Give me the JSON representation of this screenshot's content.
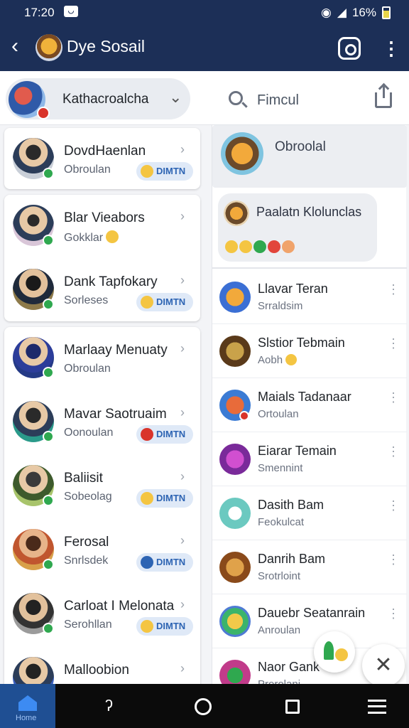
{
  "status": {
    "time": "17:20",
    "battery": "16%"
  },
  "header": {
    "title": "Dye Sosail"
  },
  "filter": {
    "selected": "Kathacroalcha",
    "search_placeholder": "Fimcul"
  },
  "left_contacts": [
    {
      "name": "DovdHaenlan",
      "sub": "Obroulan",
      "tag": "DIMTN",
      "tag_color": "#f4c542"
    },
    {
      "name": "Blar Vieabors",
      "sub": "Gokklar",
      "emoji": true
    },
    {
      "name": "Dank Tapfokary",
      "sub": "Sorleses",
      "tag": "DIMTN",
      "tag_color": "#f4c542"
    },
    {
      "name": "Marlaay Menuaty",
      "sub": "Obroulan"
    },
    {
      "name": "Mavar Saotruaim",
      "sub": "Oonoulan",
      "tag": "DIMTN",
      "tag_color": "#d9342b"
    },
    {
      "name": "Baliisit",
      "sub": "Sobeolag",
      "tag": "DIMTN",
      "tag_color": "#f4c542"
    },
    {
      "name": "Ferosal",
      "sub": "Snrlsdek",
      "tag": "DIMTN",
      "tag_color": "#2d64b3"
    },
    {
      "name": "Carloat I Melonata",
      "sub": "Serohllan",
      "tag": "DIMTN",
      "tag_color": "#f4c542"
    },
    {
      "name": "Malloobion",
      "sub": ""
    }
  ],
  "right_panel": {
    "group_name": "Obroolal",
    "bubble_name": "Paalatn Klolunclas",
    "items": [
      {
        "name": "Llavar Teran",
        "sub": "Srraldsim",
        "color": "#f2a93b"
      },
      {
        "name": "Slstior Tebmain",
        "sub": "Aobh",
        "color": "#8a6a3a"
      },
      {
        "name": "Maials Tadanaar",
        "sub": "Ortoulan",
        "color": "#e86b3a"
      },
      {
        "name": "Eiarar Temain",
        "sub": "Smennint",
        "color": "#9b3bbf"
      },
      {
        "name": "Dasith Bam",
        "sub": "Feokulcat",
        "color": "#6bc9c0"
      },
      {
        "name": "Danrih Bam",
        "sub": "Srotrloint",
        "color": "#c0762f"
      },
      {
        "name": "Dauebr Seatanrain",
        "sub": "Anroulan",
        "color": "#4e7bd4"
      },
      {
        "name": "Naor Gank",
        "sub": "Prorolani",
        "color": "#c13b8a"
      }
    ]
  },
  "nav": {
    "home_label": "Home"
  }
}
